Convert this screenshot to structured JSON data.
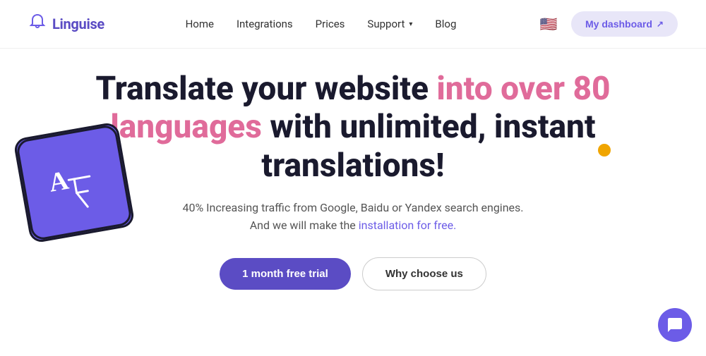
{
  "navbar": {
    "logo": {
      "text": "Linguise",
      "icon": "🔔"
    },
    "links": [
      {
        "label": "Home",
        "hasDropdown": false
      },
      {
        "label": "Integrations",
        "hasDropdown": false
      },
      {
        "label": "Prices",
        "hasDropdown": false
      },
      {
        "label": "Support",
        "hasDropdown": true
      },
      {
        "label": "Blog",
        "hasDropdown": false
      }
    ],
    "dashboard_button": "My dashboard",
    "flag_emoji": "🇺🇸"
  },
  "hero": {
    "title_part1": "Translate your website ",
    "title_highlight": "into over 80 languages",
    "title_part2": " with unlimited, instant translations!",
    "subtitle_line1": "40% Increasing traffic from Google, Baidu or Yandex search engines.",
    "subtitle_line2": "And we will make the ",
    "subtitle_link": "installation for free.",
    "cta_primary": "1 month free trial",
    "cta_secondary": "Why choose us"
  },
  "chat": {
    "icon_label": "chat-icon"
  },
  "colors": {
    "purple": "#6c5ce7",
    "pink": "#e06b9a",
    "orange": "#f0a500",
    "dark": "#1a1a2e"
  }
}
